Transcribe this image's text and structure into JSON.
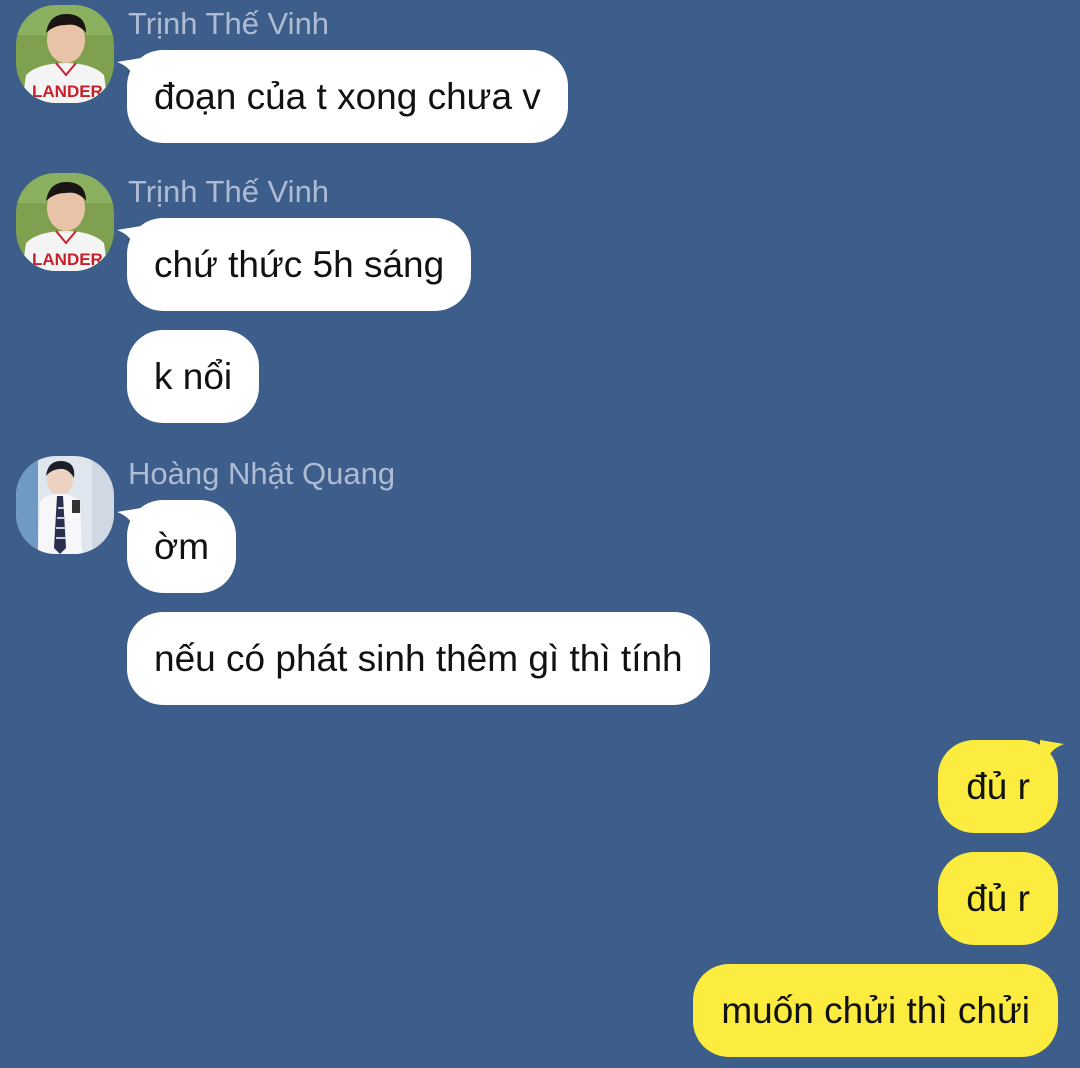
{
  "colors": {
    "background": "#3d5d8a",
    "incoming_bubble": "#ffffff",
    "outgoing_bubble": "#fcec3f",
    "sender_name": "#aebbd2"
  },
  "groups": [
    {
      "sender": "Trịnh Thế Vinh",
      "avatar": "baseball-player-avatar",
      "messages": [
        "đoạn của t xong chưa v"
      ]
    },
    {
      "sender": "Trịnh Thế Vinh",
      "avatar": "baseball-player-avatar",
      "messages": [
        "chứ thức 5h sáng",
        "k nổi"
      ]
    },
    {
      "sender": "Hoàng Nhật Quang",
      "avatar": "student-phone-avatar",
      "messages": [
        "ờm",
        "nếu có phát sinh thêm gì thì tính"
      ]
    }
  ],
  "outgoing": [
    "đủ r",
    "đủ r",
    "muốn chửi thì chửi"
  ]
}
